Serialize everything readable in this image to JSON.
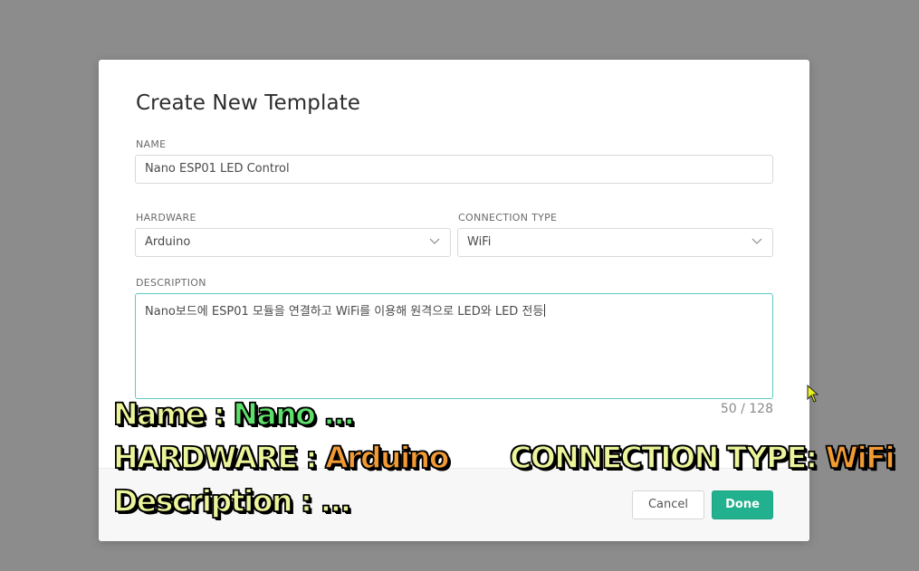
{
  "dialog": {
    "title": "Create New Template",
    "name_label": "NAME",
    "name_value": "Nano ESP01 LED Control",
    "hardware_label": "HARDWARE",
    "hardware_value": "Arduino",
    "connection_label": "CONNECTION TYPE",
    "connection_value": "WiFi",
    "description_label": "DESCRIPTION",
    "description_value": "Nano보드에 ESP01 모듈을 연결하고 WiFi를 이용해 원격으로 LED와 LED 전등",
    "char_counter": "50 / 128",
    "cancel_label": "Cancel",
    "done_label": "Done"
  },
  "overlay": {
    "line1_key": "Name :",
    "line1_value": "Nano ...",
    "line2_key": "HARDWARE :",
    "line2_value": "Arduino",
    "line2b_key": "CONNECTION TYPE:",
    "line2b_value": "WiFi",
    "line3": "Description : ..."
  },
  "colors": {
    "accent": "#22b18f",
    "focus_border": "#5fc9c1",
    "backdrop": "#8c8c8c",
    "caption_light": "#ecf59a",
    "caption_green": "#5ee06b",
    "caption_orange": "#f29a33"
  },
  "icons": {
    "select_arrow": "chevron-down-icon",
    "pointer": "mouse-cursor-icon"
  }
}
